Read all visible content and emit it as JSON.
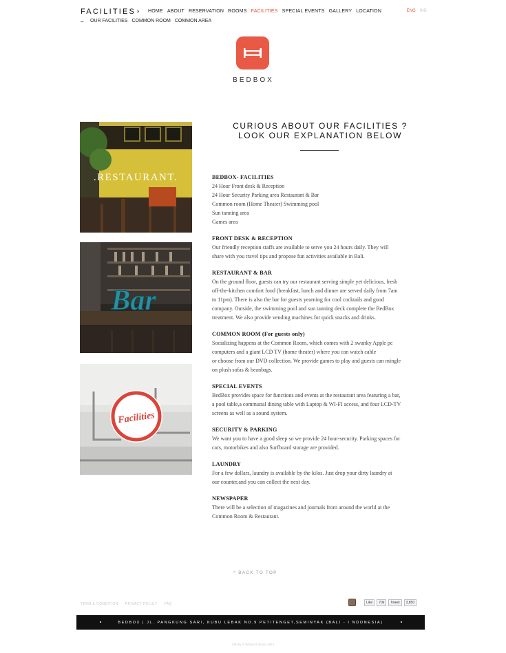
{
  "header": {
    "title": "FACILITIES",
    "chevron": "›",
    "nav": [
      "HOME",
      "ABOUT",
      "RESERVATION",
      "ROOMS",
      "FACILITIES",
      "SPECIAL EVENTS",
      "GALLERY",
      "LOCATION"
    ],
    "active_nav": "FACILITIES",
    "lang": {
      "active": "ENG",
      "inactive": "IND"
    },
    "sub_dash": "–",
    "sub_nav": [
      "OUR FACILITIES",
      "COMMON ROOM",
      "COMMON AREA"
    ]
  },
  "brand": {
    "name": "BEDBOX",
    "logo_icon": "bed-icon",
    "logo_color": "#e85a45"
  },
  "images": [
    {
      "caption": ".RESTAURANT.",
      "icon": "restaurant-photo"
    },
    {
      "caption": "Bar",
      "icon": "bar-photo"
    },
    {
      "caption": "Facilities",
      "icon": "bedroom-photo"
    }
  ],
  "main": {
    "heading_line1": "CURIOUS ABOUT OUR FACILITIES ?",
    "heading_line2": "LOOK OUR EXPLANATION BELOW",
    "sections": [
      {
        "title": "BEDBOX- FACILITIES",
        "lines": [
          "24 Hour Front desk  & Reception",
          "24 Hour Security Parking area Restaurant & Bar",
          "Common room (Home Theater) Swimming pool",
          "Sun tanning area",
          "Games area"
        ]
      },
      {
        "title": "FRONT DESK & RECEPTION",
        "lines": [
          "Our friendly reception staffs are available to serve you 24 hours daily. They will",
          "share with you travel tips and propose fun activities available in Bali."
        ]
      },
      {
        "title": "RESTAURANT & BAR",
        "lines": [
          "On the ground floor,  guests can try our restaurant serving simple yet delicious, fresh",
          "off-the-kitchen comfort food (breakfast, lunch and dinner are served daily from 7am",
          "to 11pm). There is also the bar for guests yearning for cool cocktails and good",
          "company. Outside, the swimming pool and sun tanning deck complete the BedBox",
          "treatment. We also provide vending machines for quick snacks and drinks."
        ]
      },
      {
        "title": "COMMON ROOM (For guests only)",
        "lines": [
          "Socializing happens at the Common Room, which comes with 2 swanky Apple pc",
          "computers and a giant LCD TV (home theater) where you can watch cable",
          "or choose from our DVD collection. We provide games to play and guests can mingle",
          "on plush sofas & beanbags."
        ]
      },
      {
        "title": "SPECIAL EVENTS",
        "lines": [
          "BedBox provides space for functions and events at the restaurant area featuring a bar,",
          "a pool table,a communal dining table with Laptop & WI-FI access, and four LCD-TV",
          "screens as well as a sound system."
        ]
      },
      {
        "title": "SECURITY & PARKING",
        "lines": [
          "We want you to have a good sleep so we provide 24 hour-security. Parking spaces for",
          "cars, motorbikes and also Surfboard storage are provided."
        ]
      },
      {
        "title": "LAUNDRY",
        "lines": [
          "For a few dollars, laundry is available by the kilos. Just drop your dirty laundry at",
          "our counter,and you can collect the next day."
        ]
      },
      {
        "title": "NEWSPAPER",
        "lines": [
          "There will be a selection of magazines and journals from around the world at the",
          "Common Room & Restaurant."
        ]
      }
    ]
  },
  "back_to_top": "^  BACK TO TOP",
  "footer": {
    "links": [
      "TERM & CONDITION",
      "PRIVACY POLICY",
      "FAQ"
    ],
    "social": {
      "like": "Like",
      "like_count": "70k",
      "tweet": "Tweet",
      "tweet_count": "3,850"
    },
    "address": "BEDBOX   |   JL. PANGKUNG SARI, KUBU LEBAK NO.9 PETITENGET,SEMINYAK (BALI - I NDONESIA)",
    "credit": "Site by ® Whatnot Studio 2014"
  }
}
